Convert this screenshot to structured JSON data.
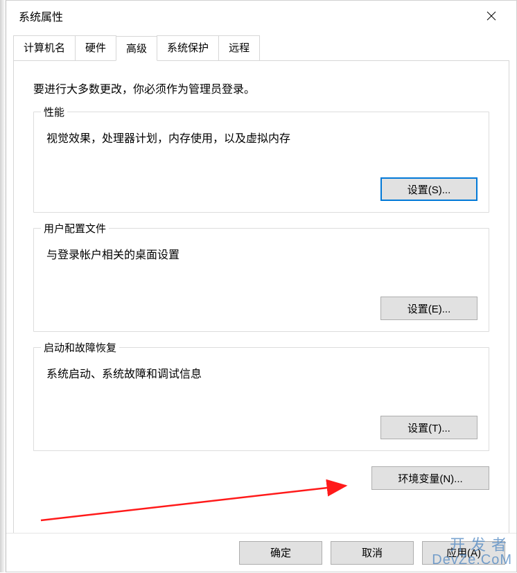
{
  "window": {
    "title": "系统属性"
  },
  "tabs": {
    "computer_name": "计算机名",
    "hardware": "硬件",
    "advanced": "高级",
    "system_protection": "系统保护",
    "remote": "远程"
  },
  "panel": {
    "intro": "要进行大多数更改，你必须作为管理员登录。",
    "performance": {
      "legend": "性能",
      "desc": "视觉效果，处理器计划，内存使用，以及虚拟内存",
      "button": "设置(S)..."
    },
    "profiles": {
      "legend": "用户配置文件",
      "desc": "与登录帐户相关的桌面设置",
      "button": "设置(E)..."
    },
    "startup": {
      "legend": "启动和故障恢复",
      "desc": "系统启动、系统故障和调试信息",
      "button": "设置(T)..."
    },
    "env_button": "环境变量(N)..."
  },
  "footer": {
    "ok": "确定",
    "cancel": "取消",
    "apply": "应用(A)"
  },
  "watermark": {
    "line1": "开发者",
    "line2": "DevZe.CoM"
  }
}
